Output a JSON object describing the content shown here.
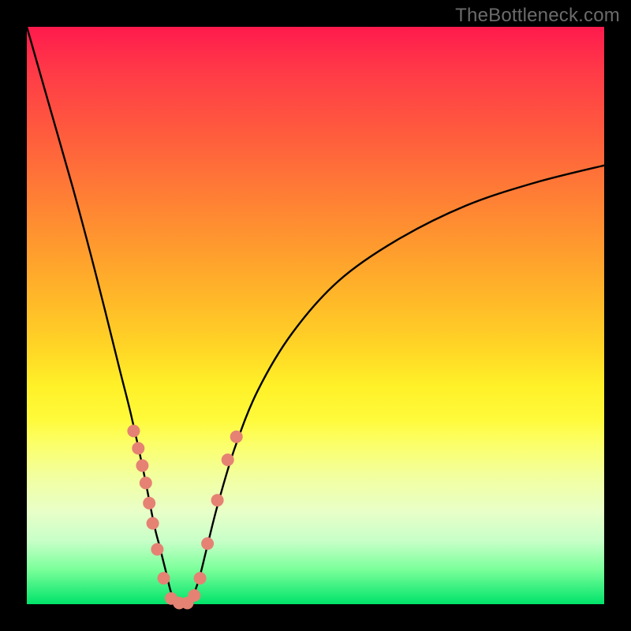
{
  "watermark": "TheBottleneck.com",
  "colors": {
    "background_frame": "#000000",
    "watermark": "#6b6b6b",
    "curve": "#000000",
    "dot_fill": "#e58274",
    "gradient_stops": [
      "#ff1a4d",
      "#ff3b47",
      "#ff5a3e",
      "#ff7a36",
      "#ff9a2e",
      "#ffbb28",
      "#ffd726",
      "#fff028",
      "#fffa3a",
      "#fcff66",
      "#f2ffa0",
      "#e8ffc8",
      "#c8ffc8",
      "#7aff9a",
      "#00e36a"
    ]
  },
  "chart_data": {
    "type": "line",
    "title": "",
    "xlabel": "",
    "ylabel": "",
    "xlim": [
      0,
      100
    ],
    "ylim": [
      0,
      100
    ],
    "description": "V-shaped bottleneck curve. Y (bottleneck %) vs X (relative component performance). Minimum ≈ 0% bottleneck near x ≈ 27; curve rises steeply toward x=0 (~100%) and gently toward x=100 (~76%).",
    "series": [
      {
        "name": "bottleneck-curve",
        "x": [
          0,
          4,
          8,
          12,
          16,
          18,
          20,
          22,
          23,
          24,
          25,
          26,
          27,
          28,
          29,
          30,
          31,
          33,
          36,
          40,
          46,
          54,
          64,
          76,
          88,
          100
        ],
        "y": [
          100,
          86,
          72,
          57,
          41,
          33,
          24,
          14,
          10,
          6,
          2,
          0.5,
          0,
          0.5,
          2,
          5,
          9,
          17,
          27,
          37,
          47,
          56,
          63,
          69,
          73,
          76
        ]
      }
    ],
    "sample_points": {
      "name": "measured-points",
      "x": [
        18.5,
        19.3,
        20.0,
        20.6,
        21.2,
        21.8,
        22.6,
        23.7,
        25.0,
        26.4,
        27.8,
        29.0,
        30.0,
        31.3,
        33.0,
        34.8,
        36.3
      ],
      "y": [
        30.0,
        27.0,
        24.0,
        21.0,
        17.5,
        14.0,
        9.5,
        4.5,
        1.0,
        0.2,
        0.2,
        1.5,
        4.5,
        10.5,
        18.0,
        25.0,
        29.0
      ]
    }
  }
}
